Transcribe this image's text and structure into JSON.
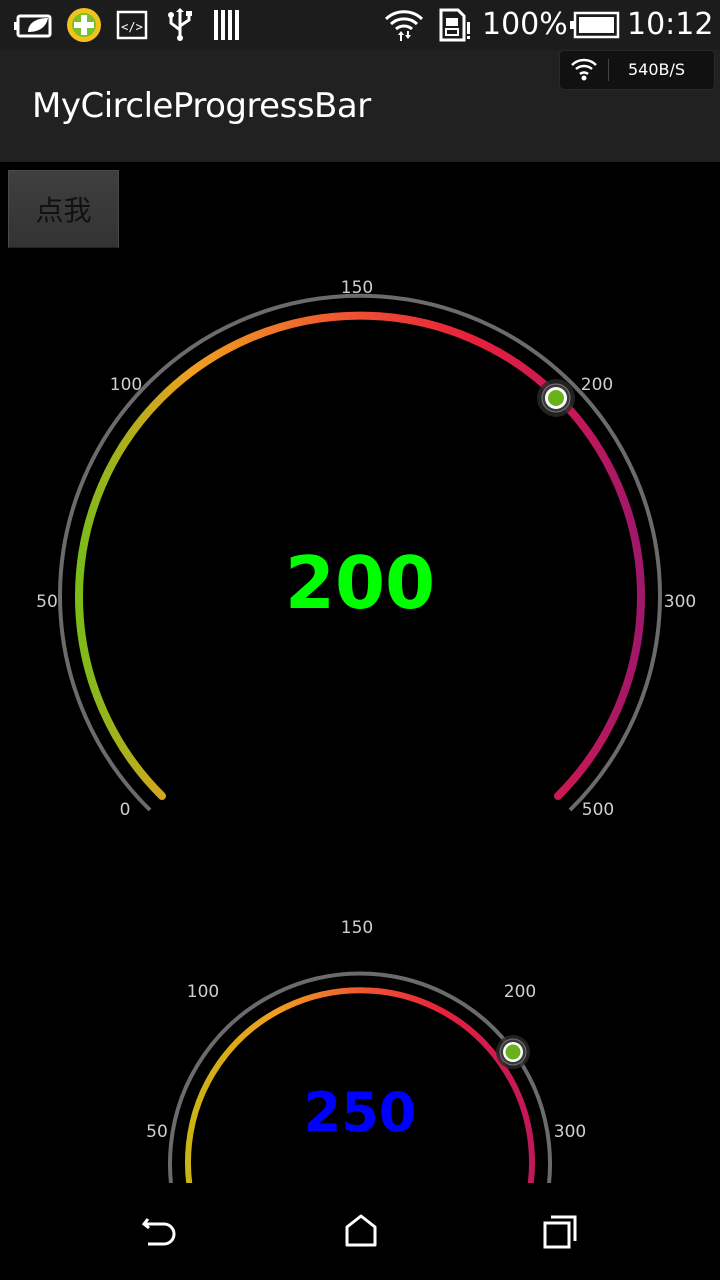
{
  "status_bar": {
    "battery_percent": "100%",
    "time": "10:12",
    "icons": [
      "leaf-battery-icon",
      "360-security-icon",
      "code-icon",
      "usb-icon",
      "barcode-icon",
      "wifi-icon",
      "sim-icon",
      "battery-icon"
    ]
  },
  "action_bar": {
    "title": "MyCircleProgressBar",
    "net_speed": "540B/S"
  },
  "button": {
    "label": "点我"
  },
  "gauge1": {
    "value": "200",
    "value_color": "#00ff00",
    "ticks": [
      "0",
      "50",
      "100",
      "150",
      "200",
      "300",
      "500"
    ]
  },
  "gauge2": {
    "value": "250",
    "value_color": "#0000ff",
    "ticks": [
      "50",
      "100",
      "150",
      "200",
      "300"
    ]
  },
  "gradient_colors": [
    "#7cbb1a",
    "#f0a020",
    "#f05a30",
    "#e8203c",
    "#c0185a",
    "#a0186a"
  ],
  "nav_bar": {
    "icons": [
      "back-icon",
      "home-icon",
      "recents-icon"
    ]
  }
}
